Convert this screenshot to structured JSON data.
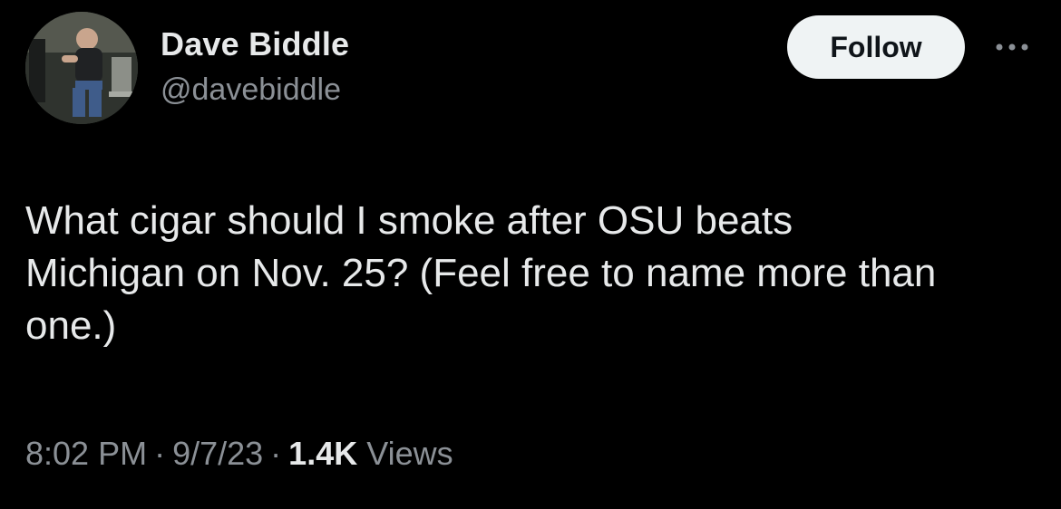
{
  "author": {
    "display_name": "Dave Biddle",
    "handle": "@davebiddle",
    "avatar_icon": "profile-photo"
  },
  "actions": {
    "follow_label": "Follow",
    "more_icon": "more-horizontal-icon"
  },
  "tweet": {
    "text": "What cigar should I smoke after OSU beats\nMichigan on Nov. 25? (Feel free to name more than\none.)"
  },
  "meta": {
    "time": "8:02 PM",
    "date": "9/7/23",
    "separator": "·",
    "views_count": "1.4K",
    "views_label": "Views"
  },
  "colors": {
    "background": "#000000",
    "primary_text": "#e7e9ea",
    "secondary_text": "#8b9096",
    "follow_button_bg": "#eff3f4",
    "follow_button_text": "#0f1419"
  }
}
